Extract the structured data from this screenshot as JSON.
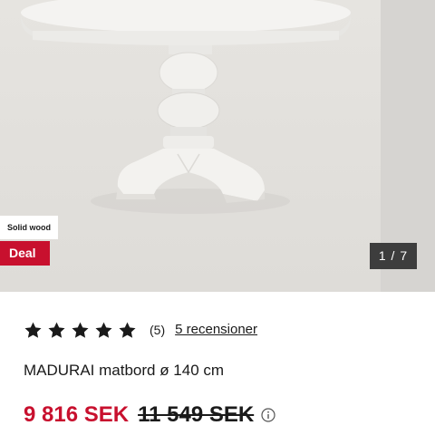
{
  "gallery": {
    "badges": {
      "material": "Solid wood",
      "deal": "Deal"
    },
    "counter": "1 / 7"
  },
  "rating": {
    "stars": 5,
    "count": "(5)",
    "reviews_link": "5 recensioner"
  },
  "product": {
    "title": "MADURAI matbord ø 140 cm"
  },
  "price": {
    "current": "9 816 SEK",
    "original": "11 549 SEK"
  },
  "colors": {
    "deal_red": "#c8102e",
    "counter_bg": "#3d3d3d",
    "text": "#1a1a1a"
  },
  "icons": {
    "star": "star-icon",
    "info": "info-icon"
  }
}
